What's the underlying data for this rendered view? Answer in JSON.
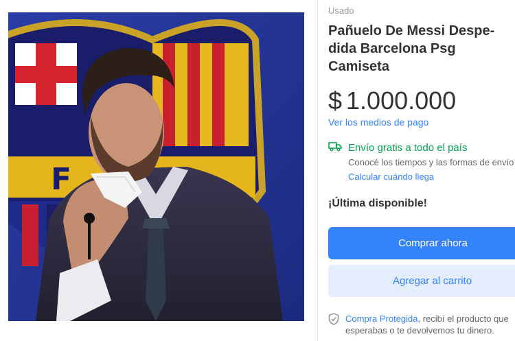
{
  "listing": {
    "condition": "Usado",
    "title_line1": "Pañuelo De Messi Despe-",
    "title_line2": "dida Barcelona Psg",
    "title_line3": "Camiseta",
    "currency": "$",
    "price": "1.000.000",
    "payment_link": "Ver los medios de pago"
  },
  "shipping": {
    "icon": "truck-icon",
    "title": "Envío gratis a todo el país",
    "subtitle": "Conocé los tiempos y las formas de envío",
    "calc_link": "Calcular cuándo llega"
  },
  "stock": {
    "label": "¡Última disponible!"
  },
  "actions": {
    "buy_label": "Comprar ahora",
    "cart_label": "Agregar al carrito"
  },
  "protection": {
    "icon": "shield-icon",
    "link": "Compra Protegida",
    "text1": ", recibí el producto que",
    "text2": "esperabas o te devolvemos tu dinero."
  },
  "colors": {
    "accent": "#3483fa",
    "shipping_green": "#00a650",
    "cart_bg": "#e3edfb"
  },
  "image": {
    "crest_letters": "F"
  }
}
